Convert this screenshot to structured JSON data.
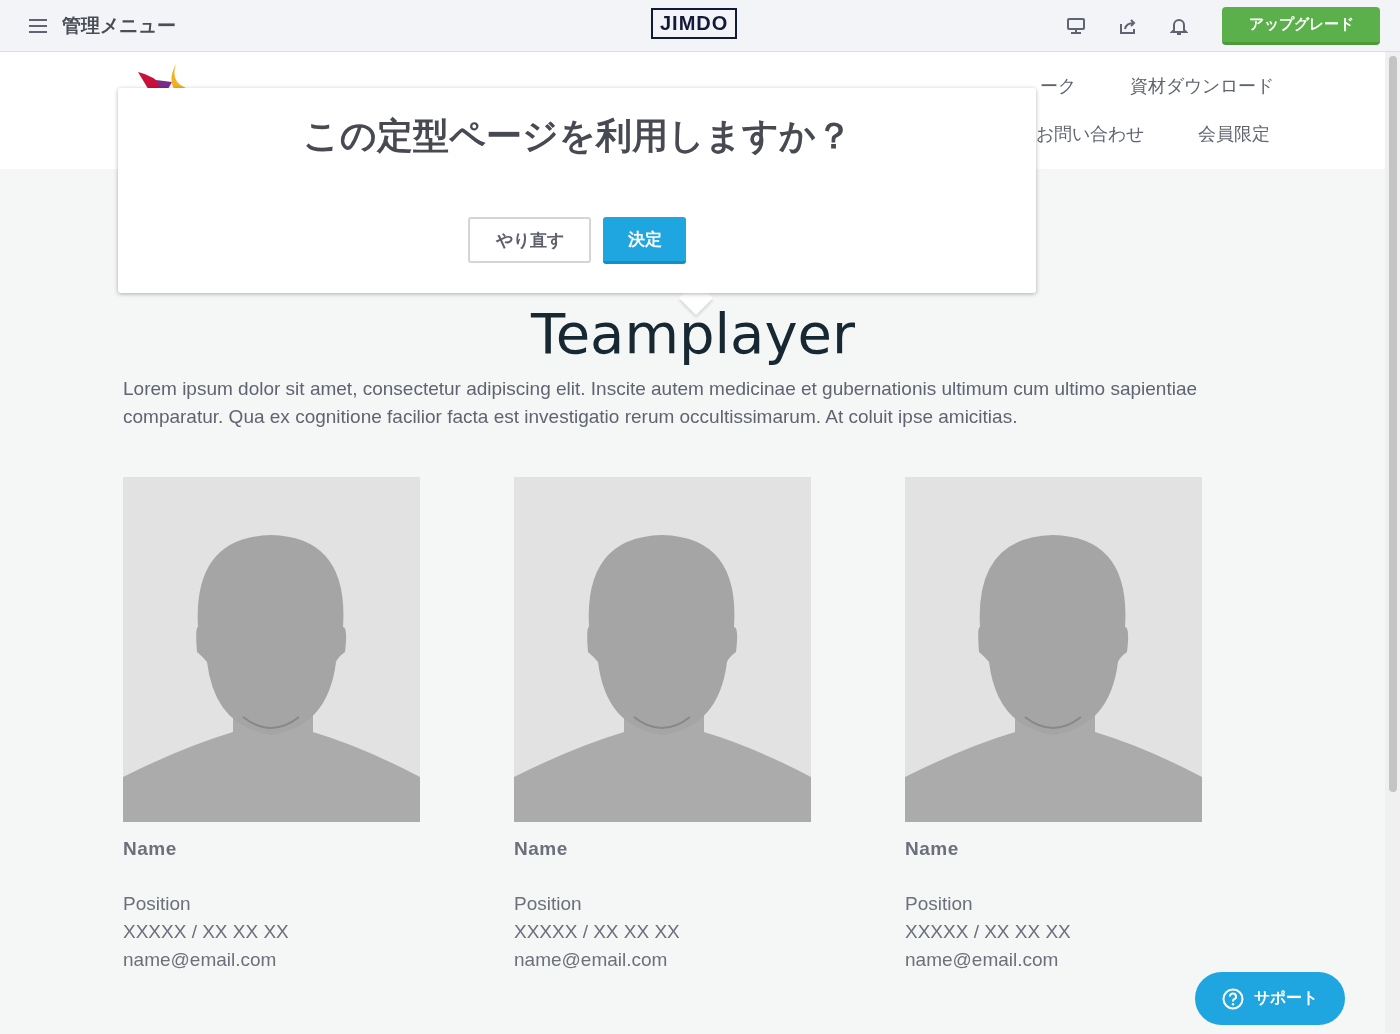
{
  "topbar": {
    "menu_label": "管理メニュー",
    "logo": "JIMDO",
    "upgrade_button": "アップグレード"
  },
  "site_header": {
    "nav_row_1": [
      "ーク",
      "資材ダウンロード"
    ],
    "nav_row_2": [
      "お問い合わせ",
      "会員限定"
    ]
  },
  "dialog": {
    "title": "この定型ページを利用しますか？",
    "buttons": [
      {
        "label": "やり直す",
        "kind": "secondary"
      },
      {
        "label": "決定",
        "kind": "primary"
      }
    ]
  },
  "section": {
    "title": "Teamplayer",
    "text": "Lorem ipsum dolor sit amet, consectetur adipiscing elit. Inscite autem medicinae et gubernationis ultimum cum ultimo sapientiae comparatur. Qua ex cognitione facilior facta est investigatio rerum occultissimarum. At coluit ipse amicitias."
  },
  "team": [
    {
      "name": "Name",
      "position": "Position",
      "phone": "XXXXX / XX XX XX",
      "email": "name@email.com"
    },
    {
      "name": "Name",
      "position": "Position",
      "phone": "XXXXX / XX XX XX",
      "email": "name@email.com"
    },
    {
      "name": "Name",
      "position": "Position",
      "phone": "XXXXX / XX XX XX",
      "email": "name@email.com"
    }
  ],
  "support_button": "サポート"
}
